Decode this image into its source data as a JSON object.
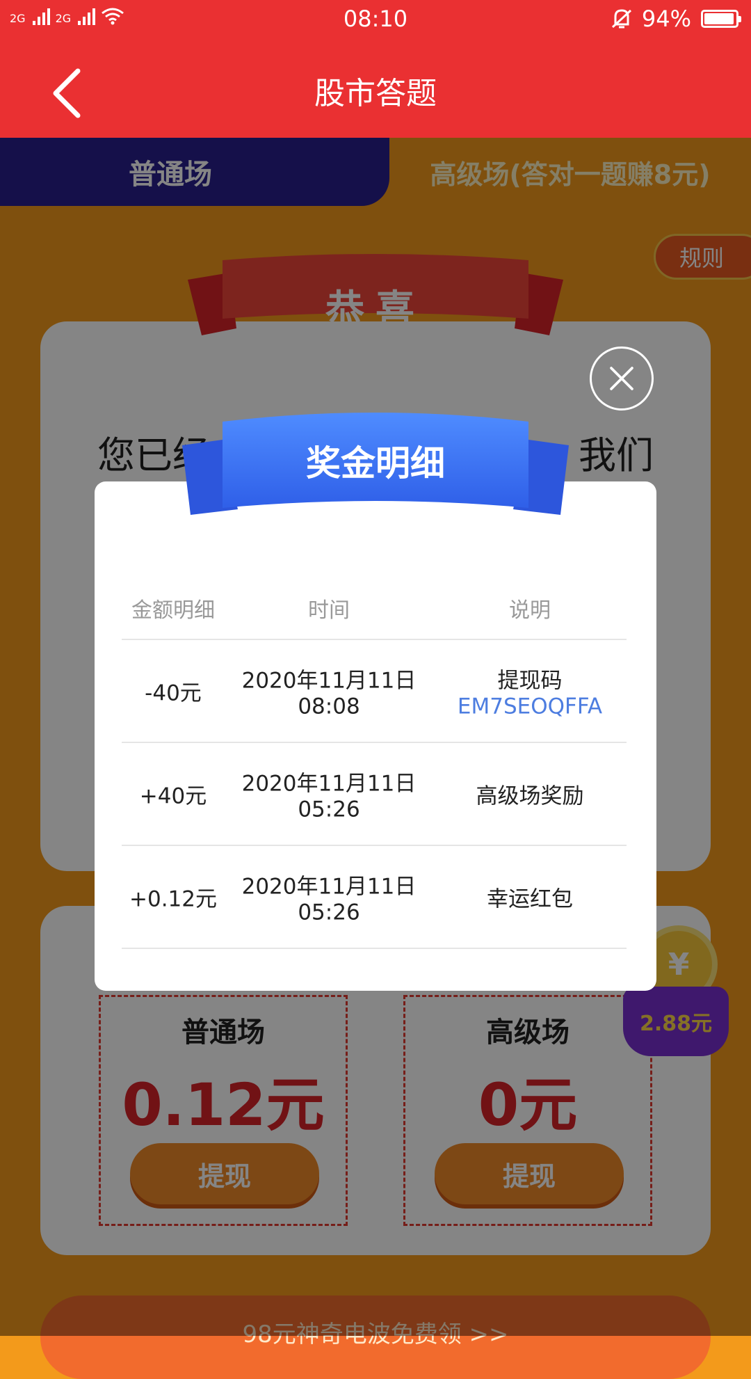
{
  "status_bar": {
    "signal1": "2G",
    "signal2": "2G",
    "time": "08:10",
    "battery": "94%"
  },
  "header": {
    "title": "股市答题"
  },
  "tabs": [
    {
      "label": "普通场"
    },
    {
      "label": "高级场(答对一题赚8元)"
    }
  ],
  "background": {
    "rules_label": "规则",
    "congrats": "恭喜",
    "text_left": "您已经",
    "text_right": "我们",
    "boxes": [
      {
        "title": "普通场",
        "amount": "0.12元",
        "button": "提现"
      },
      {
        "title": "高级场",
        "amount": "0元",
        "button": "提现"
      }
    ],
    "coin_symbol": "¥",
    "bag_amount": "2.88元",
    "bottom_banner": "98元神奇电波免费领 >>"
  },
  "modal": {
    "title": "奖金明细",
    "headers": [
      "金额明细",
      "时间",
      "说明"
    ],
    "rows": [
      {
        "amount": "-40元",
        "time": "2020年11月11日 08:08",
        "desc": "提现码",
        "code": "EM7SEOQFFA"
      },
      {
        "amount": "+40元",
        "time": "2020年11月11日 05:26",
        "desc": "高级场奖励",
        "code": ""
      },
      {
        "amount": "+0.12元",
        "time": "2020年11月11日 05:26",
        "desc": "幸运红包",
        "code": ""
      }
    ]
  },
  "colors": {
    "header_red": "#ea3032",
    "tab_navy": "#2a1f8f",
    "background_orange": "#f39a1b",
    "ribbon_blue": "#3a6ff0",
    "link_blue": "#4d7de0"
  },
  "icons": [
    "back-arrow-icon",
    "wifi-icon",
    "bell-mute-icon",
    "battery-icon",
    "close-icon",
    "coin-icon"
  ]
}
